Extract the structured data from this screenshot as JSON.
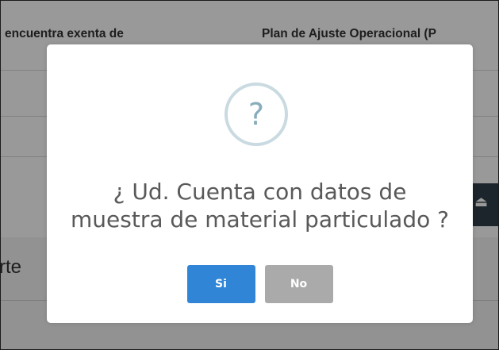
{
  "background": {
    "columns": [
      "encuentra exenta de",
      "Plan de Ajuste Operacional (P"
    ],
    "footer_title": "rte"
  },
  "dialog": {
    "icon": "question-icon",
    "icon_glyph": "?",
    "title_lines": [
      "¿ Ud. Cuenta con datos de",
      "muestra de material particulado ?"
    ],
    "confirm_label": "Si",
    "cancel_label": "No",
    "confirm_color": "#3085d6",
    "cancel_color": "#aaaaaa"
  }
}
